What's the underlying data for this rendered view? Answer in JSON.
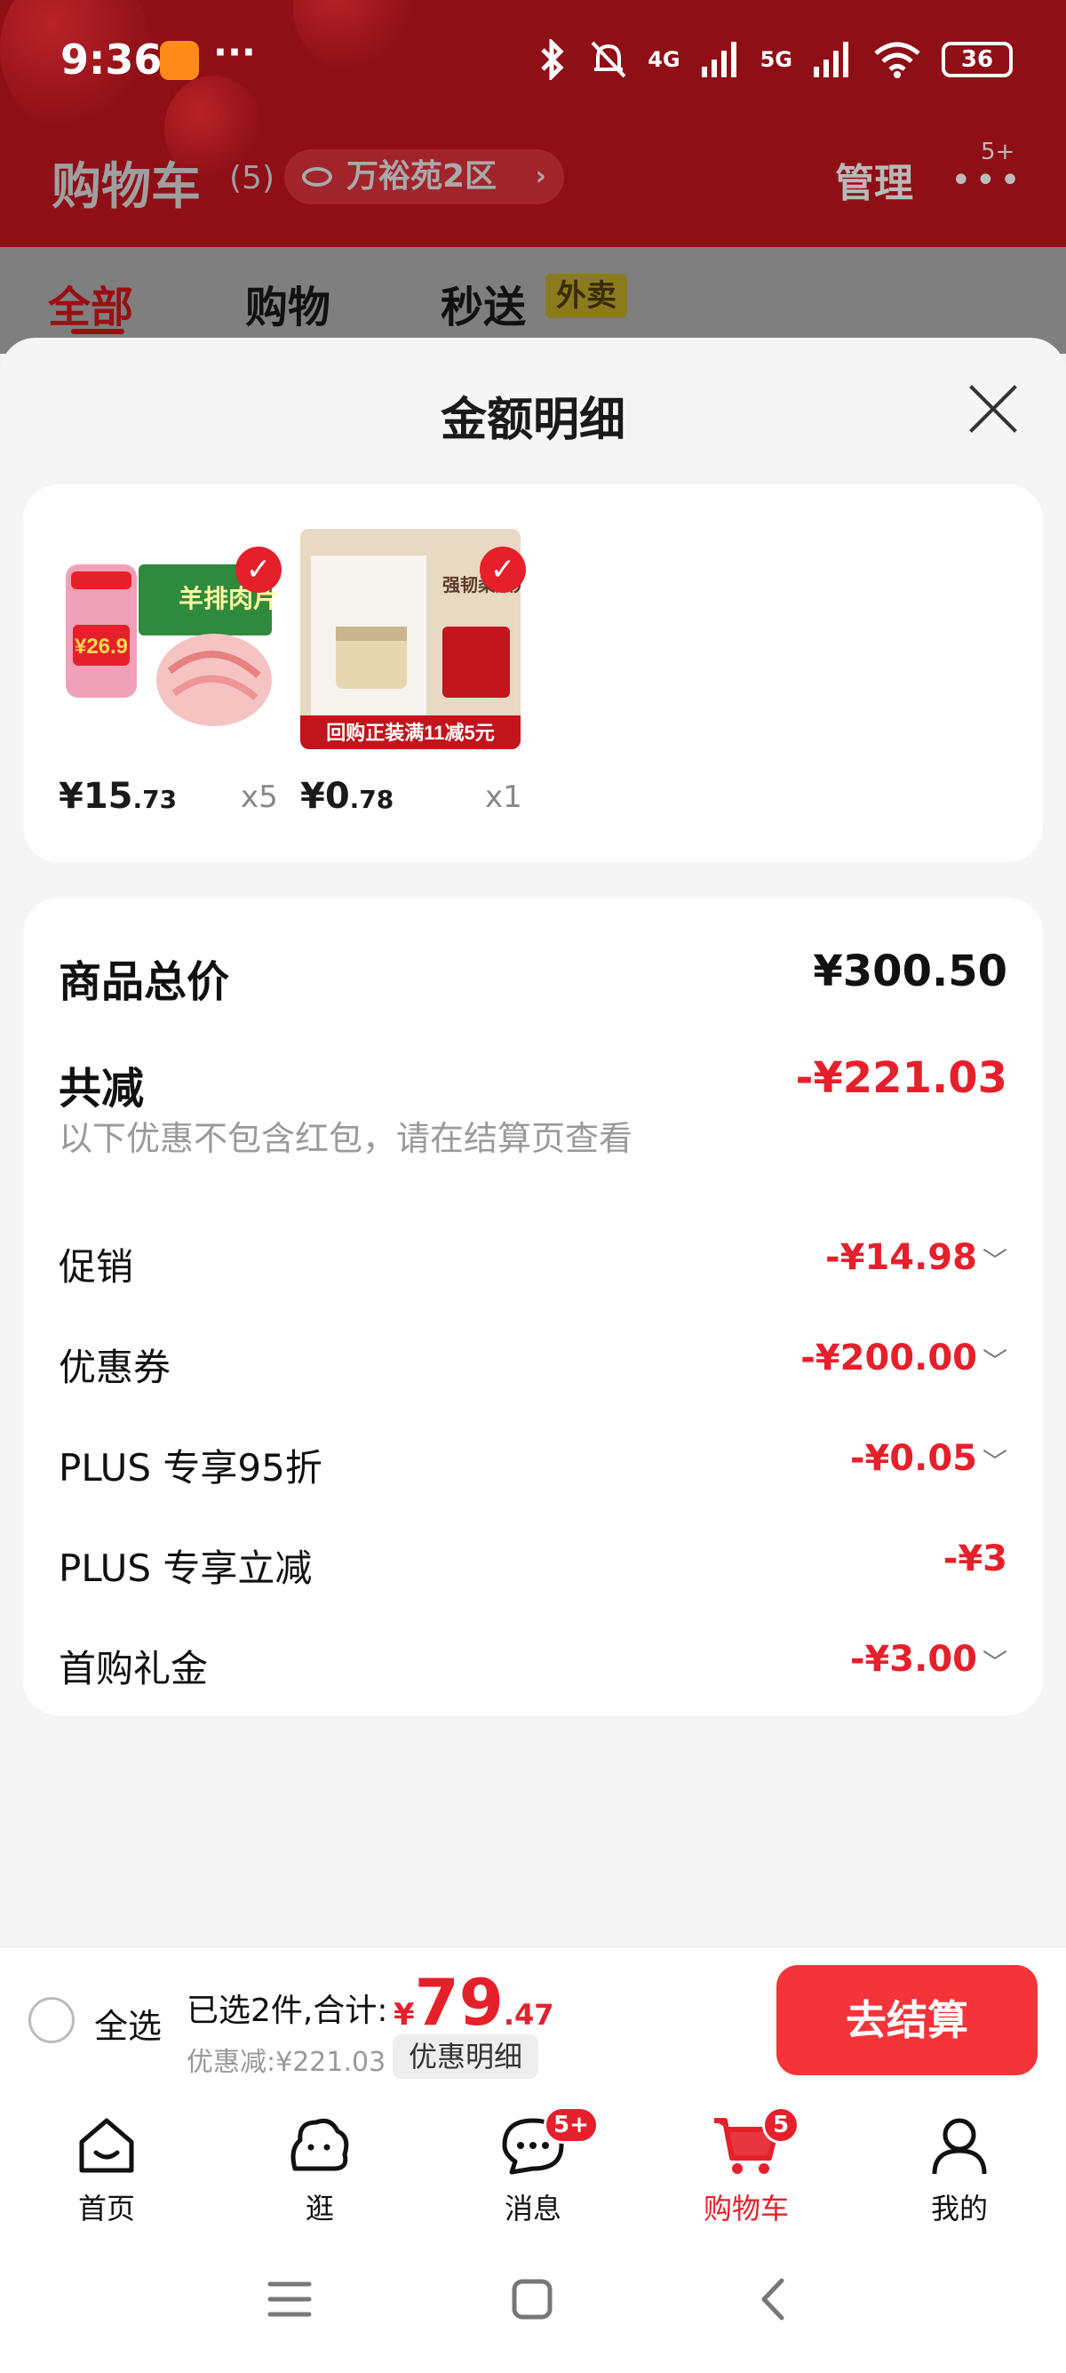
{
  "status_bar": {
    "time": "9:36",
    "dots": "···",
    "network_1": "4G",
    "network_2": "5G",
    "battery": "36"
  },
  "header": {
    "title": "购物车",
    "count": "(5)",
    "address": "万裕苑2区",
    "manage": "管理",
    "more_badge": "5+"
  },
  "tabs": [
    {
      "label": "全部",
      "active": true
    },
    {
      "label": "购物"
    },
    {
      "label": "秒送",
      "badge": "外卖"
    }
  ],
  "modal": {
    "title": "金额明细",
    "products": [
      {
        "price_int": "¥15",
        "price_dec": ".73",
        "qty": "x5",
        "image": "lamb-rolls-package",
        "img_text": "羊排肉片",
        "price_tag": "¥26.9"
      },
      {
        "price_int": "¥0",
        "price_dec": ".78",
        "qty": "x1",
        "image": "cream-jar-sample",
        "banner": "回购正装满11减5元",
        "img_text": "强韧柔顺光泽"
      }
    ],
    "total_label": "商品总价",
    "total_value": "¥300.50",
    "reduce_label": "共减",
    "reduce_value": "-¥221.03",
    "note": "以下优惠不包含红包，请在结算页查看",
    "discounts": [
      {
        "label": "促销",
        "value": "-¥14.98",
        "expandable": true
      },
      {
        "label": "优惠券",
        "value": "-¥200.00",
        "expandable": true
      },
      {
        "label": "PLUS 专享95折",
        "value": "-¥0.05",
        "expandable": true
      },
      {
        "label": "PLUS 专享立减",
        "value": "-¥3",
        "expandable": false
      },
      {
        "label": "首购礼金",
        "value": "-¥3.00",
        "expandable": true
      }
    ]
  },
  "checkout": {
    "select_all": "全选",
    "summary": "已选2件,合计:",
    "price_yen": "¥",
    "price_int": "79",
    "price_dec": ".47",
    "discount": "优惠减:¥221.03",
    "detail_button": "优惠明细",
    "checkout_button": "去结算"
  },
  "nav": [
    {
      "label": "首页",
      "icon": "home-icon"
    },
    {
      "label": "逛",
      "icon": "browse-icon"
    },
    {
      "label": "消息",
      "icon": "message-icon",
      "badge": "5+"
    },
    {
      "label": "购物车",
      "icon": "cart-icon",
      "badge": "5",
      "active": true
    },
    {
      "label": "我的",
      "icon": "profile-icon"
    }
  ],
  "colors": {
    "accent": "#e5202b",
    "header_bg": "#8f0f17"
  }
}
